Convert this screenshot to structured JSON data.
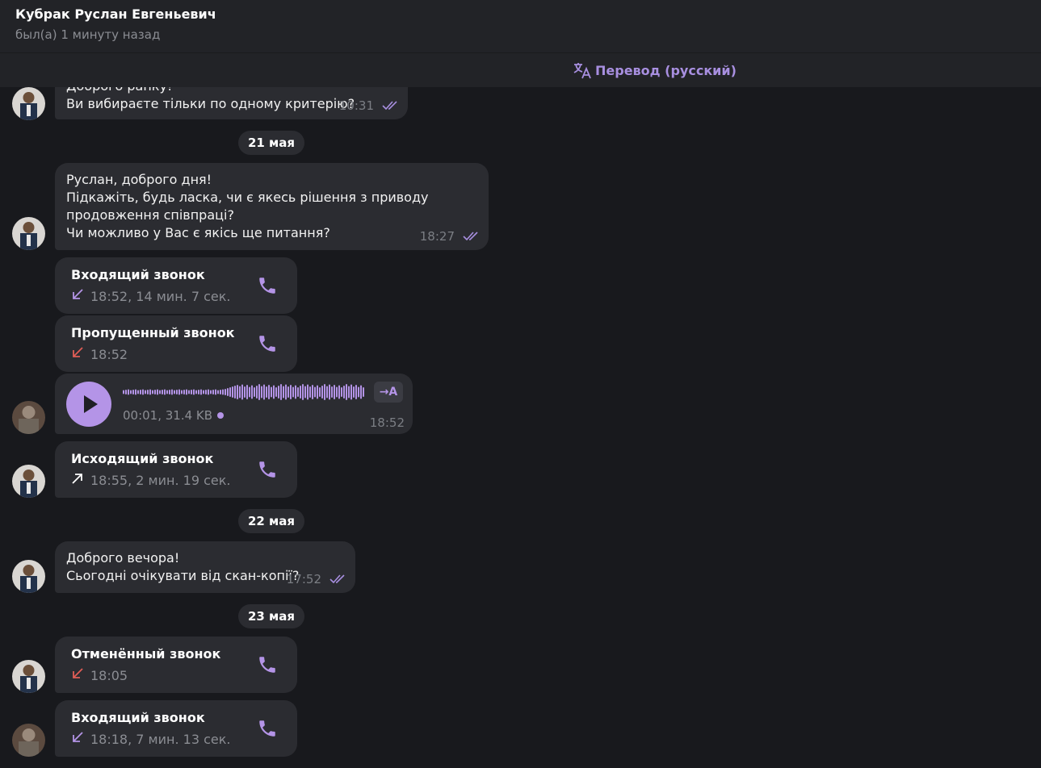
{
  "header": {
    "name": "Кубрак Руслан Евгеньевич",
    "status": "был(а) 1 минуту назад"
  },
  "translate": {
    "label": "Перевод (русский)"
  },
  "messages": {
    "m1": {
      "line1": "Доброго ранку!",
      "line2": "Ви вибираєте тільки по одному критерію?",
      "time": "10:31"
    },
    "m2": {
      "line1": "Руслан, доброго дня!",
      "line2": "Підкажіть, будь ласка, чи є якесь рішення з приводу",
      "line3": "продовження співпраці?",
      "line4": "Чи можливо у Вас є якісь ще питання?",
      "time": "18:27"
    },
    "m3": {
      "line1": "Доброго вечора!",
      "line2": "Сьогодні очікувати від скан-копії?",
      "time": "17:52"
    }
  },
  "dates": {
    "d1": "21 мая",
    "d2": "22 мая",
    "d3": "23 мая"
  },
  "calls": {
    "c1": {
      "title": "Входящий звонок",
      "info": "18:52, 14 мин. 7 сек.",
      "direction": "incoming"
    },
    "c2": {
      "title": "Пропущенный звонок",
      "info": "18:52",
      "direction": "missed"
    },
    "c3": {
      "title": "Исходящий звонок",
      "info": "18:55, 2 мин. 19 сек.",
      "direction": "outgoing"
    },
    "c4": {
      "title": "Отменённый звонок",
      "info": "18:05",
      "direction": "cancelled"
    },
    "c5": {
      "title": "Входящий звонок",
      "info": "18:18, 7 мин. 13 сек.",
      "direction": "incoming"
    }
  },
  "voice": {
    "info": "00:01, 31.4 KB",
    "time": "18:52",
    "transcribe_label": "→A"
  },
  "colors": {
    "accent": "#b494e7",
    "missed": "#e05d56",
    "bubble": "#2b2c31",
    "background": "#18191d"
  }
}
